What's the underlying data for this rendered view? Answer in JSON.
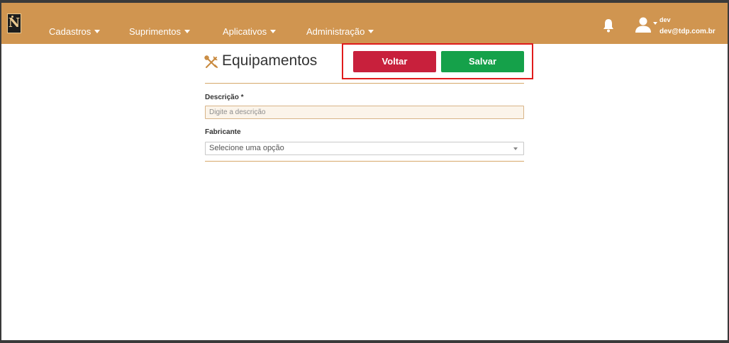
{
  "app": {
    "logo_text": "N"
  },
  "nav": {
    "menus": [
      {
        "label": "Cadastros"
      },
      {
        "label": "Suprimentos"
      },
      {
        "label": "Aplicativos"
      },
      {
        "label": "Administração"
      }
    ],
    "user": {
      "name": "dev",
      "email": "dev@tdp.com.br"
    },
    "icons": [
      "bell-icon",
      "user-icon"
    ]
  },
  "page": {
    "title": "Equipamentos",
    "title_icon": "tools-icon",
    "actions": {
      "back_label": "Voltar",
      "save_label": "Salvar"
    }
  },
  "form": {
    "descricao": {
      "label": "Descrição *",
      "placeholder": "Digite a descrição",
      "value": ""
    },
    "fabricante": {
      "label": "Fabricante",
      "selected": "Selecione uma opção"
    }
  },
  "colors": {
    "navbar": "#d09550",
    "back_button": "#c8203c",
    "save_button": "#15a14a",
    "highlight": "#e01b1b"
  }
}
